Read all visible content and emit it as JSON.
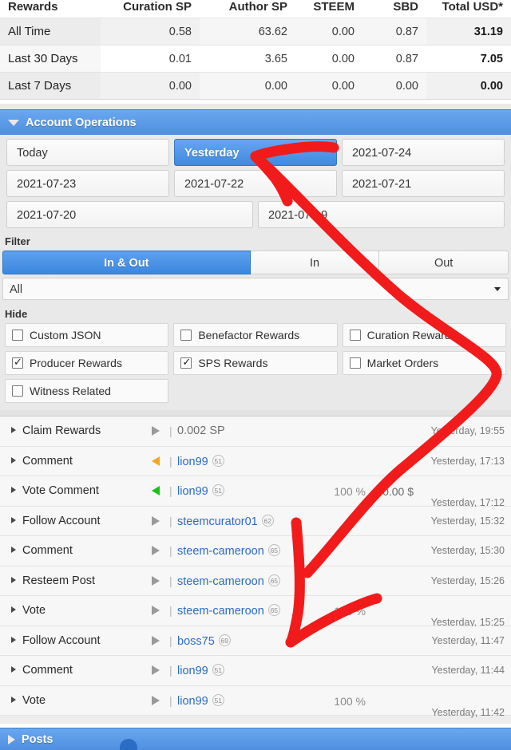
{
  "rewards_table": {
    "headers": [
      "Rewards",
      "Curation SP",
      "Author SP",
      "STEEM",
      "SBD",
      "Total USD*"
    ],
    "rows": [
      {
        "label": "All Time",
        "curation_sp": "0.58",
        "author_sp": "63.62",
        "steem": "0.00",
        "sbd": "0.87",
        "total_usd": "31.19"
      },
      {
        "label": "Last 30 Days",
        "curation_sp": "0.01",
        "author_sp": "3.65",
        "steem": "0.00",
        "sbd": "0.87",
        "total_usd": "7.05"
      },
      {
        "label": "Last 7 Days",
        "curation_sp": "0.00",
        "author_sp": "0.00",
        "steem": "0.00",
        "sbd": "0.00",
        "total_usd": "0.00"
      }
    ]
  },
  "account_operations": {
    "title": "Account Operations",
    "date_buttons": [
      {
        "label": "Today",
        "active": false,
        "wide": false
      },
      {
        "label": "Yesterday",
        "active": true,
        "wide": false
      },
      {
        "label": "2021-07-24",
        "active": false,
        "wide": false
      },
      {
        "label": "2021-07-23",
        "active": false,
        "wide": false
      },
      {
        "label": "2021-07-22",
        "active": false,
        "wide": false
      },
      {
        "label": "2021-07-21",
        "active": false,
        "wide": false
      },
      {
        "label": "2021-07-20",
        "active": false,
        "wide": true
      },
      {
        "label": "2021-07-19",
        "active": false,
        "wide": true
      }
    ],
    "filter": {
      "label": "Filter",
      "segments": [
        {
          "label": "In & Out",
          "active": true
        },
        {
          "label": "In",
          "active": false
        },
        {
          "label": "Out",
          "active": false
        }
      ],
      "select_value": "All"
    },
    "hide": {
      "label": "Hide",
      "checkboxes": [
        {
          "label": "Custom JSON",
          "checked": false
        },
        {
          "label": "Benefactor Rewards",
          "checked": false
        },
        {
          "label": "Curation Rewards",
          "checked": false
        },
        {
          "label": "Producer Rewards",
          "checked": true
        },
        {
          "label": "SPS Rewards",
          "checked": true
        },
        {
          "label": "Market Orders",
          "checked": false
        },
        {
          "label": "Witness Related",
          "checked": false
        }
      ]
    },
    "operations": [
      {
        "title": "Claim Rewards",
        "dir": "right",
        "amount": "0.002 SP",
        "user": null,
        "rep": null,
        "pct": null,
        "usd": null,
        "time": "Yesterday, 19:55",
        "time_low": false
      },
      {
        "title": "Comment",
        "dir": "left-orange",
        "amount": null,
        "user": "lion99",
        "rep": "51",
        "pct": null,
        "usd": null,
        "time": "Yesterday, 17:13",
        "time_low": false
      },
      {
        "title": "Vote Comment",
        "dir": "left-green",
        "amount": null,
        "user": "lion99",
        "rep": "51",
        "pct": "100 %",
        "usd": "0.00 $",
        "time": "Yesterday, 17:12",
        "time_low": true
      },
      {
        "title": "Follow Account",
        "dir": "right",
        "amount": null,
        "user": "steemcurator01",
        "rep": "62",
        "pct": null,
        "usd": null,
        "time": "Yesterday, 15:32",
        "time_low": false
      },
      {
        "title": "Comment",
        "dir": "right",
        "amount": null,
        "user": "steem-cameroon",
        "rep": "65",
        "pct": null,
        "usd": null,
        "time": "Yesterday, 15:30",
        "time_low": false
      },
      {
        "title": "Resteem Post",
        "dir": "right",
        "amount": null,
        "user": "steem-cameroon",
        "rep": "65",
        "pct": null,
        "usd": null,
        "time": "Yesterday, 15:26",
        "time_low": false
      },
      {
        "title": "Vote",
        "dir": "right",
        "amount": null,
        "user": "steem-cameroon",
        "rep": "65",
        "pct": "100 %",
        "usd": null,
        "time": "Yesterday, 15:25",
        "time_low": true
      },
      {
        "title": "Follow Account",
        "dir": "right",
        "amount": null,
        "user": "boss75",
        "rep": "69",
        "pct": null,
        "usd": null,
        "time": "Yesterday, 11:47",
        "time_low": false
      },
      {
        "title": "Comment",
        "dir": "right",
        "amount": null,
        "user": "lion99",
        "rep": "51",
        "pct": null,
        "usd": null,
        "time": "Yesterday, 11:44",
        "time_low": false
      },
      {
        "title": "Vote",
        "dir": "right",
        "amount": null,
        "user": "lion99",
        "rep": "51",
        "pct": "100 %",
        "usd": null,
        "time": "Yesterday, 11:42",
        "time_low": true
      }
    ]
  },
  "posts_section": {
    "title": "Posts"
  },
  "annotation": {
    "color": "#f21b1b",
    "shape": "curved-arrow-pointing-to-yesterday-button"
  },
  "colors": {
    "accent_blue": "#4f8fe0",
    "link_blue": "#2b6cc4",
    "panel_gray": "#e9e9e9",
    "row_gray": "#f7f7f7",
    "annotation_red": "#f21b1b"
  }
}
